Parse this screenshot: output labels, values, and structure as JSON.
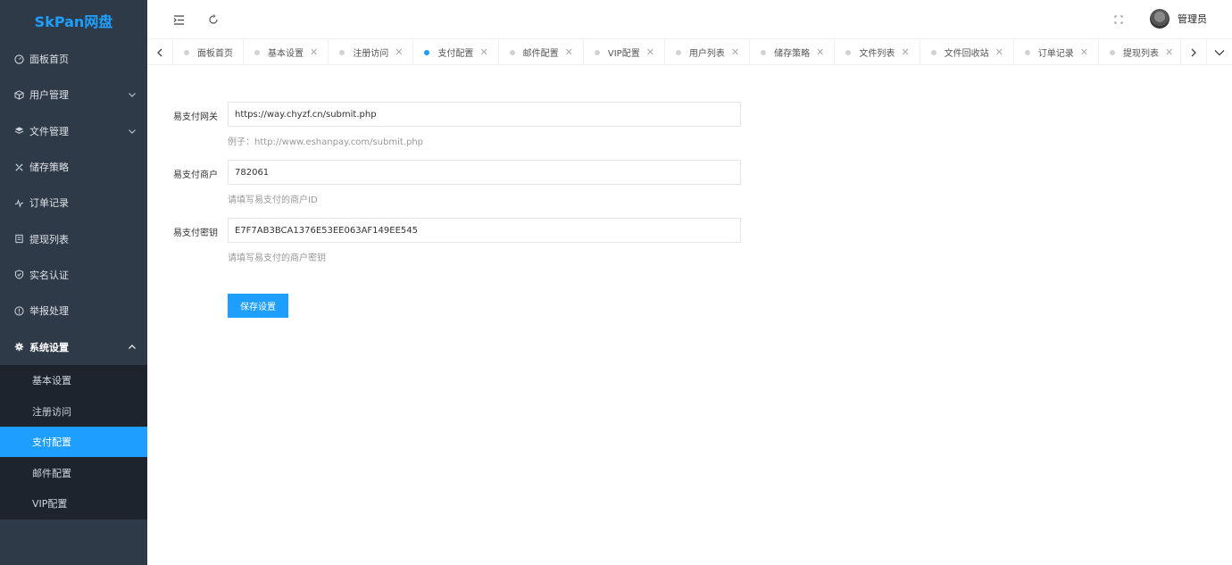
{
  "app": {
    "logo": "SkPan网盘"
  },
  "sidebar": {
    "items": [
      {
        "label": "面板首页",
        "icon": "dashboard-icon"
      },
      {
        "label": "用户管理",
        "icon": "user-cube-icon",
        "expandable": true
      },
      {
        "label": "文件管理",
        "icon": "layers-icon",
        "expandable": true
      },
      {
        "label": "储存策略",
        "icon": "tools-icon"
      },
      {
        "label": "订单记录",
        "icon": "activity-icon"
      },
      {
        "label": "提现列表",
        "icon": "list-icon"
      },
      {
        "label": "实名认证",
        "icon": "shield-check-icon"
      },
      {
        "label": "举报处理",
        "icon": "info-icon"
      },
      {
        "label": "系统设置",
        "icon": "gear-icon",
        "expanded": true
      }
    ],
    "submenu": [
      {
        "label": "基本设置"
      },
      {
        "label": "注册访问"
      },
      {
        "label": "支付配置",
        "active": true
      },
      {
        "label": "邮件配置"
      },
      {
        "label": "VIP配置"
      }
    ]
  },
  "header": {
    "user_name": "管理员"
  },
  "tabs": [
    {
      "label": "面板首页",
      "closable": false
    },
    {
      "label": "基本设置",
      "closable": true
    },
    {
      "label": "注册访问",
      "closable": true
    },
    {
      "label": "支付配置",
      "closable": true,
      "active": true
    },
    {
      "label": "邮件配置",
      "closable": true
    },
    {
      "label": "VIP配置",
      "closable": true
    },
    {
      "label": "用户列表",
      "closable": true
    },
    {
      "label": "储存策略",
      "closable": true
    },
    {
      "label": "文件列表",
      "closable": true
    },
    {
      "label": "文件回收站",
      "closable": true
    },
    {
      "label": "订单记录",
      "closable": true
    },
    {
      "label": "提现列表",
      "closable": true
    }
  ],
  "form": {
    "gateway": {
      "label": "易支付网关",
      "value": "https://way.chyzf.cn/submit.php",
      "tip": "例子：http://www.eshanpay.com/submit.php"
    },
    "merchant": {
      "label": "易支付商户",
      "value": "782061",
      "tip": "请填写易支付的商户ID"
    },
    "secret": {
      "label": "易支付密钥",
      "value": "E7F7AB3BCA1376E53EE063AF149EE545",
      "tip": "请填写易支付的商户密钥"
    },
    "save_label": "保存设置"
  },
  "colors": {
    "accent": "#1e9fff",
    "sidebar_bg": "#2f3a48",
    "submenu_bg": "#1d242d"
  }
}
